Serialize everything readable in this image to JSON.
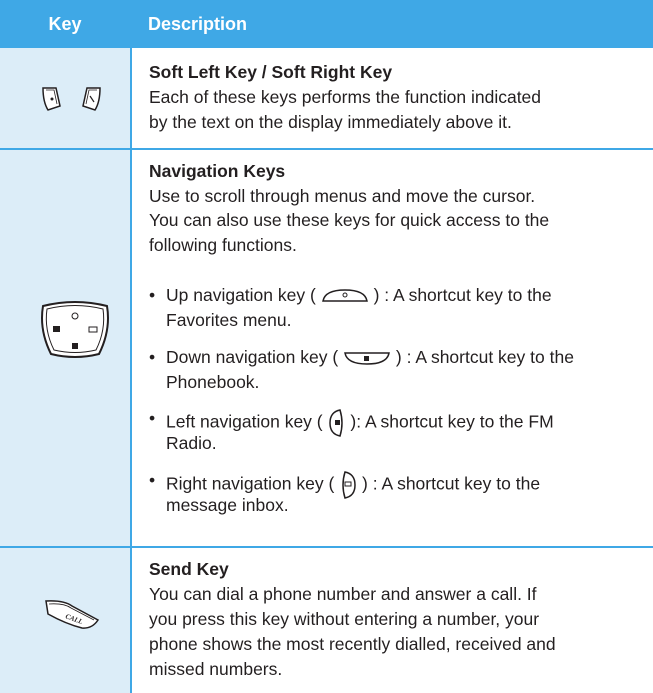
{
  "header": {
    "key": "Key",
    "description": "Description"
  },
  "rows": [
    {
      "icon": "soft-keys-icon",
      "title": "Soft Left Key / Soft Right Key",
      "lines": [
        "Each of these keys performs the function indicated",
        "by the text on the display immediately above it."
      ]
    },
    {
      "icon": "navigation-keys-icon",
      "title": "Navigation Keys",
      "lines": [
        "Use to scroll through menus and move the cursor.",
        "You can also use these keys for quick access to the",
        "following functions."
      ],
      "bullets": [
        {
          "before": "Up navigation key (",
          "after": ") : A shortcut key to the",
          "cont": "Favorites menu.",
          "icon": "up-navigation-icon"
        },
        {
          "before": "Down navigation key (",
          "after": ") : A shortcut key to the",
          "cont": "Phonebook.",
          "icon": "down-navigation-icon"
        },
        {
          "before": "Left navigation key (",
          "after": "): A shortcut key to the FM",
          "cont": "Radio.",
          "icon": "left-navigation-icon"
        },
        {
          "before": "Right navigation key (",
          "after": ") : A shortcut key to the",
          "cont": "message inbox.",
          "icon": "right-navigation-icon"
        }
      ]
    },
    {
      "icon": "send-key-icon",
      "title": "Send Key",
      "lines": [
        "You can dial a phone number and answer a call. If",
        "you press this key without entering a number, your",
        "phone shows the most recently dialled, received and",
        "missed numbers."
      ]
    }
  ],
  "bullet_glyph": "•",
  "send_icon_text": "CALL"
}
